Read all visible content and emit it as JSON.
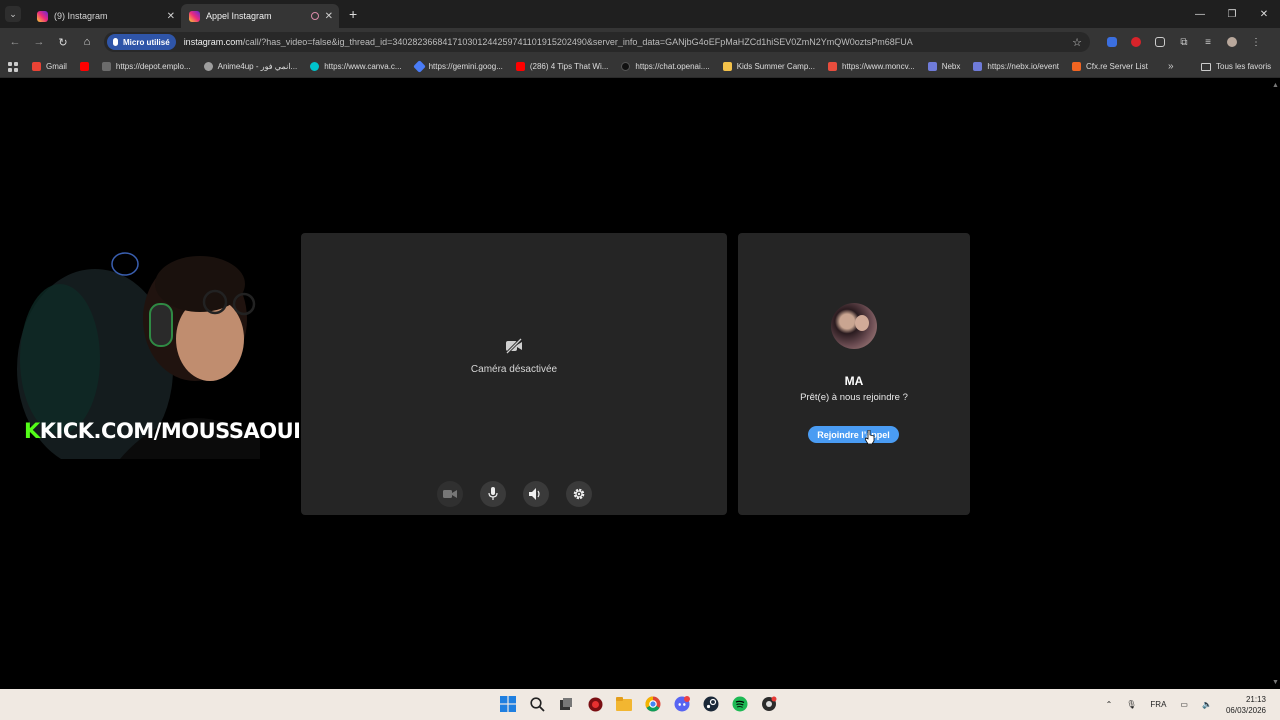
{
  "browser": {
    "tabs": [
      {
        "title": "(9) Instagram"
      },
      {
        "title": "Appel Instagram"
      }
    ],
    "mic_chip": "Micro utilisé",
    "url_host": "instagram.com",
    "url_path": "/call/?has_video=false&ig_thread_id=340282366841710301244259741101915202490&server_info_data=GANjbG4oEFpMaHZCd1hiSEV0ZmN2YmQW0oztsPm68FUA",
    "bookmarks": [
      {
        "label": "Gmail",
        "color": "#ea4335"
      },
      {
        "label": "",
        "color": "#ff0000"
      },
      {
        "label": "https://depot.emplo...",
        "color": "#6b6b6b"
      },
      {
        "label": "Anime4up - انمي فور...",
        "color": "#9e9e9e"
      },
      {
        "label": "https://www.canva.c...",
        "color": "#00c4cc"
      },
      {
        "label": "https://gemini.goog...",
        "color": "#4a7cf6"
      },
      {
        "label": "(286) 4 Tips That Wi...",
        "color": "#ff0000"
      },
      {
        "label": "https://chat.openai....",
        "color": "#111111"
      },
      {
        "label": "Kids Summer Camp...",
        "color": "#f4c24a"
      },
      {
        "label": "https://www.moncv...",
        "color": "#e84d3d"
      },
      {
        "label": "Nebx",
        "color": "#6f7bd9"
      },
      {
        "label": "https://nebx.io/event",
        "color": "#6f7bd9"
      },
      {
        "label": "Cfx.re Server List",
        "color": "#f26522"
      }
    ],
    "all_bookmarks": "Tous les favoris"
  },
  "call": {
    "camera_off_label": "Caméra désactivée",
    "callee_name": "MA",
    "join_prompt": "Prêt(e) à nous rejoindre ?",
    "join_button": "Rejoindre l’appel"
  },
  "overlay": {
    "brand_letter": "K",
    "brand_text": "KICK.COM/MOUSSAOUI"
  },
  "taskbar": {
    "language": "FRA",
    "time": "21:13",
    "date": "06/03/2026"
  },
  "colors": {
    "accent_blue": "#4a9cf3",
    "kick_green": "#53fc18"
  }
}
